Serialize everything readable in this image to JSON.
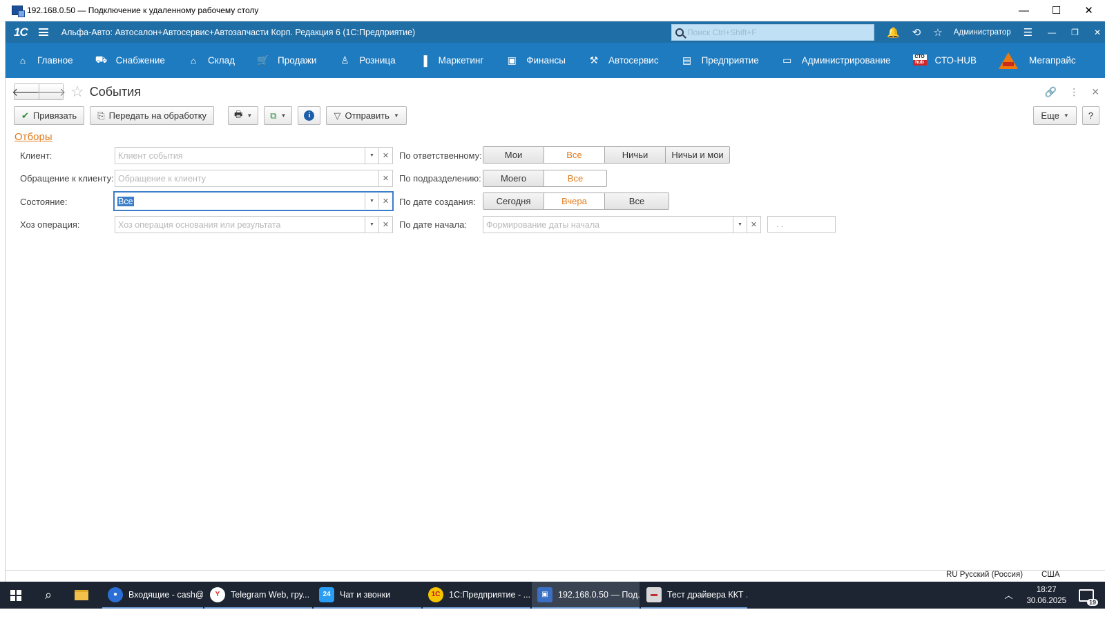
{
  "rdp": {
    "title": "192.168.0.50 — Подключение к удаленному рабочему столу",
    "controls": [
      "—",
      "☐",
      "✕"
    ]
  },
  "header": {
    "logo": "1С",
    "app_title": "Альфа-Авто: Автосалон+Автосервис+Автозапчасти Корп. Редакция 6  (1С:Предприятие)",
    "search_placeholder": "Поиск Ctrl+Shift+F",
    "user": "Администратор",
    "icons": [
      "bell-icon",
      "history-icon",
      "star-icon",
      "settings-icon"
    ]
  },
  "sections": [
    {
      "label": "Главное",
      "icon": "⌂"
    },
    {
      "label": "Снабжение",
      "icon": "⛟"
    },
    {
      "label": "Склад",
      "icon": "⌂"
    },
    {
      "label": "Продажи",
      "icon": "🛒"
    },
    {
      "label": "Розница",
      "icon": "♙"
    },
    {
      "label": "Маркетинг",
      "icon": "▐"
    },
    {
      "label": "Финансы",
      "icon": "▣"
    },
    {
      "label": "Автосервис",
      "icon": "⚒"
    },
    {
      "label": "Предприятие",
      "icon": "▤"
    },
    {
      "label": "Администрирование",
      "icon": "▭"
    },
    {
      "label": "СТО-HUB",
      "icon_top": "СТО",
      "icon_bottom": "hub"
    },
    {
      "label": "Мегапрайс",
      "icon": "triangle"
    }
  ],
  "form": {
    "title": "События",
    "commands": {
      "bind": "Привязать",
      "send_to_processing": "Передать на обработку",
      "send": "Отправить",
      "more": "Еще",
      "help": "?"
    }
  },
  "filters": {
    "header": "Отборы",
    "client_label": "Клиент:",
    "client_placeholder": "Клиент события",
    "appeal_label": "Обращение к клиенту:",
    "appeal_placeholder": "Обращение к клиенту",
    "state_label": "Состояние:",
    "state_value": "Все",
    "operation_label": "Хоз операция:",
    "operation_placeholder": "Хоз операция основания или результата",
    "responsible_label": "По ответственному:",
    "responsible_options": [
      "Мои",
      "Все",
      "Ничьи",
      "Ничьи и мои"
    ],
    "responsible_active": "Все",
    "department_label": "По подразделению:",
    "department_options": [
      "Моего",
      "Все"
    ],
    "department_active": "Все",
    "created_label": "По дате создания:",
    "created_options": [
      "Сегодня",
      "Вчера",
      "Все"
    ],
    "created_active": "Вчера",
    "start_label": "По дате начала:",
    "start_placeholder": "Формирование даты начала",
    "start_date": ". ."
  },
  "status": {
    "language": "RU Русский (Россия)",
    "keyboard": "США"
  },
  "taskbar": {
    "tasks": [
      {
        "label": "Входящие - cash@...",
        "color": "#2b6fd6",
        "glyph": "●"
      },
      {
        "label": "Telegram Web, гру...",
        "color": "#ffffff",
        "glyph": "Y"
      },
      {
        "label": "Чат и звонки",
        "color": "#2a9df4",
        "glyph": "24"
      },
      {
        "label": "1С:Предприятие - ...",
        "color": "#f5c400",
        "glyph": "1С"
      },
      {
        "label": "192.168.0.50 — Под...",
        "color": "#3a6fc4",
        "glyph": "▣"
      },
      {
        "label": "Тест драйвера ККТ ...",
        "color": "#d8d8d8",
        "glyph": "▬"
      }
    ],
    "time": "18:27",
    "date": "30.06.2025",
    "notifications": "19"
  }
}
